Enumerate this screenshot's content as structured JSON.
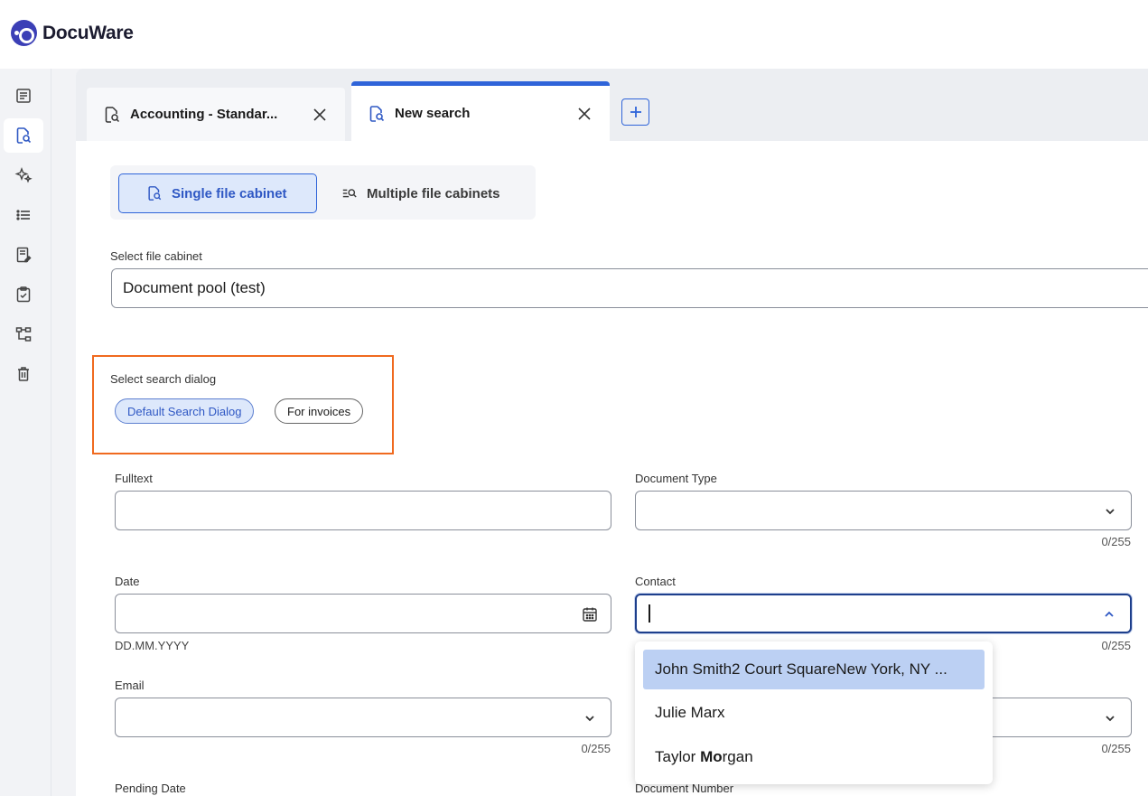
{
  "app": {
    "name": "DocuWare"
  },
  "sidebar": {
    "items": [
      {
        "icon": "document-list-icon",
        "active": false
      },
      {
        "icon": "document-search-icon",
        "active": true
      },
      {
        "icon": "sparkle-icon",
        "active": false
      },
      {
        "icon": "list-icon",
        "active": false
      },
      {
        "icon": "document-edit-icon",
        "active": false
      },
      {
        "icon": "clipboard-check-icon",
        "active": false
      },
      {
        "icon": "workflow-icon",
        "active": false
      },
      {
        "icon": "trash-icon",
        "active": false
      }
    ]
  },
  "tabs": [
    {
      "label": "Accounting - Standar...",
      "active": false
    },
    {
      "label": "New search",
      "active": true
    }
  ],
  "search_mode": {
    "single_label": "Single file cabinet",
    "multiple_label": "Multiple file cabinets",
    "selected": "single"
  },
  "file_cabinet": {
    "label": "Select file cabinet",
    "value": "Document pool (test)"
  },
  "search_dialog": {
    "label": "Select search dialog",
    "options": [
      "Default Search Dialog",
      "For invoices"
    ],
    "selected": "Default Search Dialog"
  },
  "fields": {
    "fulltext": {
      "label": "Fulltext",
      "value": ""
    },
    "document_type": {
      "label": "Document Type",
      "value": "",
      "counter": "0/255"
    },
    "date": {
      "label": "Date",
      "value": "",
      "hint": "DD.MM.YYYY"
    },
    "contact": {
      "label": "Contact",
      "value": "",
      "counter": "0/255"
    },
    "email": {
      "label": "Email",
      "value": "",
      "counter": "0/255"
    },
    "hidden_right": {
      "counter": "0/255"
    },
    "pending_date": {
      "label": "Pending Date"
    },
    "document_number": {
      "label": "Document Number"
    }
  },
  "contact_dropdown": {
    "options": [
      {
        "label": "John Smith2 Court SquareNew York, NY ...",
        "selected": true
      },
      {
        "label": "Julie Marx",
        "selected": false
      },
      {
        "label_pre": "Taylor ",
        "label_bold": "Mo",
        "label_post": "rgan",
        "selected": false
      }
    ]
  },
  "colors": {
    "accent": "#2f64d9",
    "highlight_box": "#f06a1f",
    "brand": "#3b3fb6"
  }
}
